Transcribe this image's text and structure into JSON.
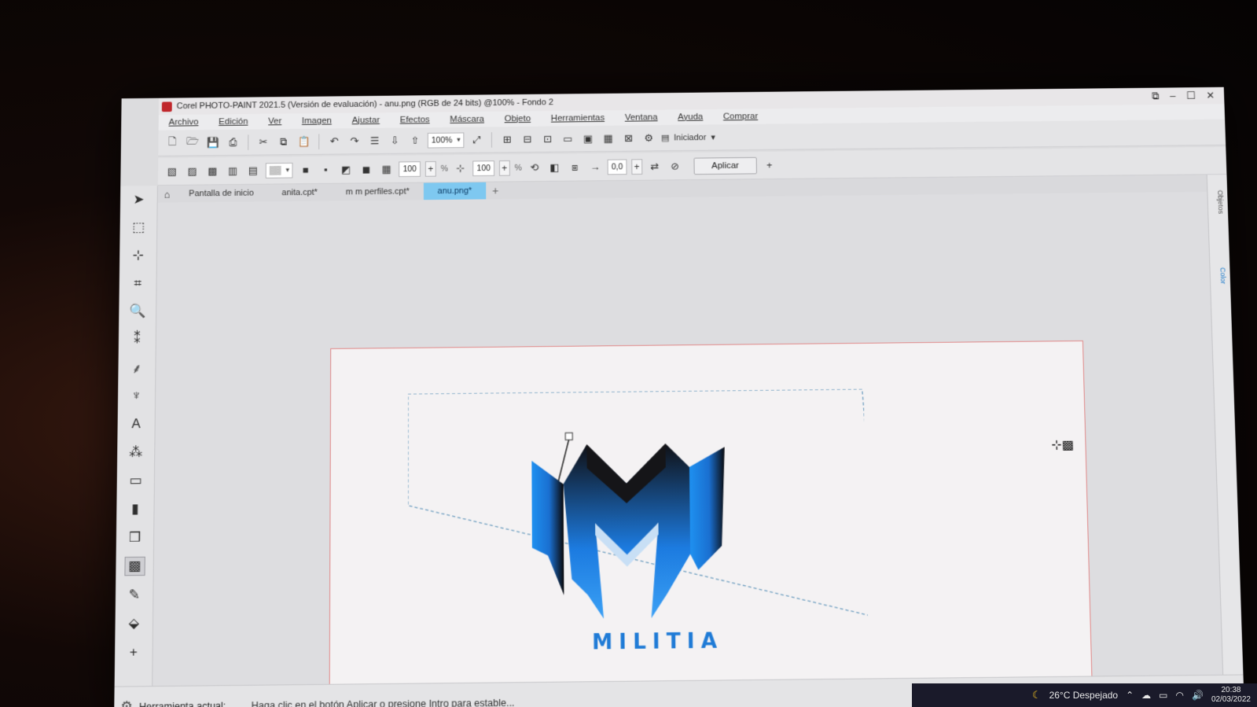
{
  "window": {
    "title": "Corel PHOTO-PAINT 2021.5 (Versión de evaluación) - anu.png (RGB de 24 bits) @100% - Fondo 2",
    "controls": [
      "restore-icon",
      "minimize-icon",
      "maximize-icon",
      "close-icon"
    ]
  },
  "menu": [
    "Archivo",
    "Edición",
    "Ver",
    "Imagen",
    "Ajustar",
    "Efectos",
    "Máscara",
    "Objeto",
    "Herramientas",
    "Ventana",
    "Ayuda",
    "Comprar"
  ],
  "toolbar1": {
    "zoom": "100%",
    "launcher": "Iniciador"
  },
  "toolbar2": {
    "value1": "100",
    "unit1": "%",
    "value2": "100",
    "unit2": "%",
    "value3": "0,0",
    "apply": "Aplicar"
  },
  "tabs": [
    {
      "label": "Pantalla de inicio",
      "active": false
    },
    {
      "label": "anita.cpt*",
      "active": false
    },
    {
      "label": "m m perfiles.cpt*",
      "active": false
    },
    {
      "label": "anu.png*",
      "active": true
    }
  ],
  "canvas": {
    "logo_text": "MILITIA",
    "colors": {
      "accent": "#1f7bd6",
      "dark": "#111111",
      "tab_active": "#7ec8f0",
      "border": "#e08888"
    }
  },
  "status": {
    "tool_label": "Herramienta actual:",
    "hint": "Haga clic en el botón Aplicar o presione Intro para estable..."
  },
  "taskbar": {
    "weather": "26°C  Despejado",
    "time": "20:38",
    "date": "02/03/2022"
  },
  "dock": {
    "tab1": "Objetos",
    "tab2": "Color"
  }
}
